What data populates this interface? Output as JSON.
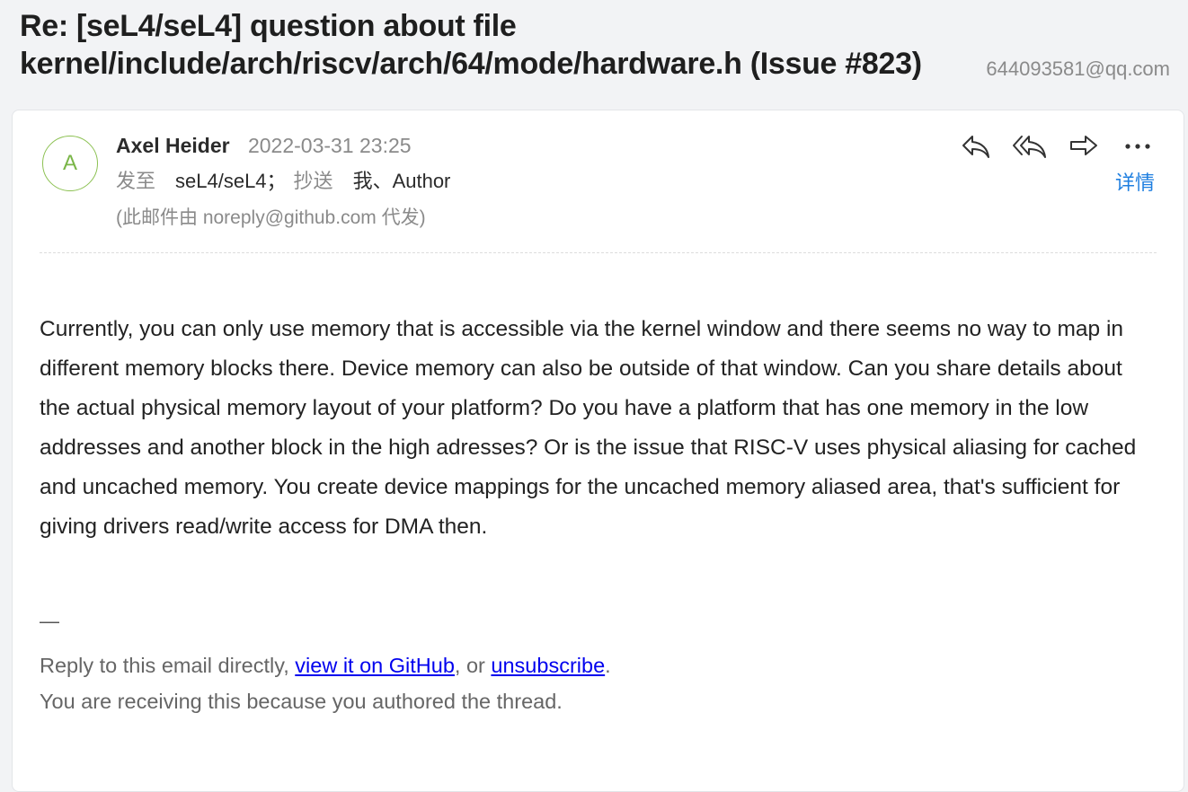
{
  "subject": "Re: [seL4/seL4] question about file kernel/include/arch/riscv/arch/64/mode/hardware.h (Issue #823)",
  "account": "644093581@qq.com",
  "email": {
    "avatar_letter": "A",
    "sender_name": "Axel Heider",
    "sent_time": "2022-03-31 23:25",
    "to_label": "发至",
    "to_value": "seL4/seL4；",
    "cc_label": "抄送",
    "cc_value": "我、Author",
    "via": "(此邮件由 noreply@github.com 代发)",
    "details_label": "详情",
    "actions": {
      "reply": "reply-icon",
      "reply_all": "reply-all-icon",
      "forward": "forward-icon",
      "more": "more-icon"
    },
    "body": "Currently, you can only use memory that is accessible via the kernel window and there seems no way to map in different memory blocks there. Device memory can also be outside of that window. Can you share details about the actual physical memory layout of your platform? Do you have a platform that has one memory in the low addresses and another block in the high adresses? Or is the issue that RISC-V uses physical aliasing for cached and uncached memory. You create device mappings for the uncached memory aliased area, that's sufficient for giving drivers read/write access for DMA then.",
    "signature_dash": "—",
    "footer": {
      "reply_text": "Reply to this email directly,",
      "github_link": "view it on GitHub",
      "or_text": ", or",
      "unsubscribe_link": "unsubscribe",
      "period": ".",
      "receiving_text": "You are receiving this because you authored the thread."
    }
  },
  "colors": {
    "accent": "#1f7fe0",
    "avatar": "#8cc152",
    "link": "#0000ee"
  }
}
